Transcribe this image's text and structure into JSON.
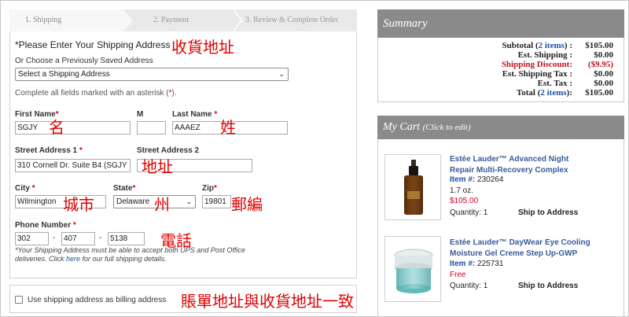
{
  "steps": {
    "step1": "1. Shipping",
    "step2": "2. Payment",
    "step3": "3. Review & Complete Order"
  },
  "form": {
    "heading": "*Please Enter Your Shipping Address",
    "heading_annotation": "收貨地址",
    "saved_label": "Or Choose a Previously Saved Address",
    "saved_select": "Select a Shipping Address",
    "required_note_a": "Complete all fields marked with an asterisk (",
    "required_note_star": "*",
    "required_note_b": ").",
    "first_name_label": "First Name",
    "middle_label": "M",
    "last_name_label": "Last Name",
    "first_name_value": "SGJY",
    "middle_value": "",
    "last_name_value": "AAAEZ",
    "first_name_annotation": "名",
    "last_name_annotation": "姓",
    "street1_label": "Street Address 1",
    "street2_label": "Street Address 2",
    "street1_value": "310 Cornell Dr. Suite B4 (SGJY",
    "street2_value": "",
    "street_annotation": "地址",
    "city_label": "City",
    "state_label": "State",
    "zip_label": "Zip",
    "city_value": "Wilmington",
    "state_value": "Delaware",
    "zip_value": "19801",
    "city_annotation": "城市",
    "state_annotation": "州",
    "zip_annotation": "郵編",
    "phone_label": "Phone Number",
    "phone1": "302",
    "phone2": "407",
    "phone3": "5138",
    "phone_dash": "-",
    "phone_annotation": "電話",
    "ups_note_line1": "*Your Shipping Address must be able to accept both UPS and Post Office",
    "ups_note_line2a": "deliveries. Click ",
    "ups_note_link": "here",
    "ups_note_line2b": " for our full shipping details.",
    "billing_label": "Use shipping address as billing address",
    "billing_annotation": "賬單地址與收貨地址一致",
    "asterisk": "*"
  },
  "summary": {
    "title": "Summary",
    "subtotal_label": "Subtotal (",
    "subtotal_items": "2 items",
    "subtotal_label_end": ") :",
    "subtotal_value": "$105.00",
    "shipping_label": "Est. Shipping :",
    "shipping_value": "$0.00",
    "discount_label": "Shipping Discount:",
    "discount_value": "($9.95)",
    "ship_tax_label": "Est. Shipping Tax :",
    "ship_tax_value": "$0.00",
    "tax_label": "Est. Tax :",
    "tax_value": "$0.00",
    "total_label": "Total (",
    "total_items": "2 items",
    "total_label_end": "):",
    "total_value": "$105.00"
  },
  "cart": {
    "title": "My Cart",
    "title_hint": "(Click to edit)",
    "items": [
      {
        "title_line1": "Estée Lauder™ Advanced Night",
        "title_line2": "Repair Multi-Recovery Complex",
        "item_label": "Item #:",
        "item_no": "230264",
        "size": "1.7 oz.",
        "price": "$105.00",
        "quantity": "Quantity: 1",
        "ship": "Ship to Address"
      },
      {
        "title_line1": "Estée Lauder™ DayWear Eye Cooling",
        "title_line2": "Moisture Gel Creme Step Up-GWP",
        "item_label": "Item #:",
        "item_no": "225731",
        "price": "Free",
        "quantity": "Quantity: 1",
        "ship": "Ship to Address"
      }
    ]
  }
}
